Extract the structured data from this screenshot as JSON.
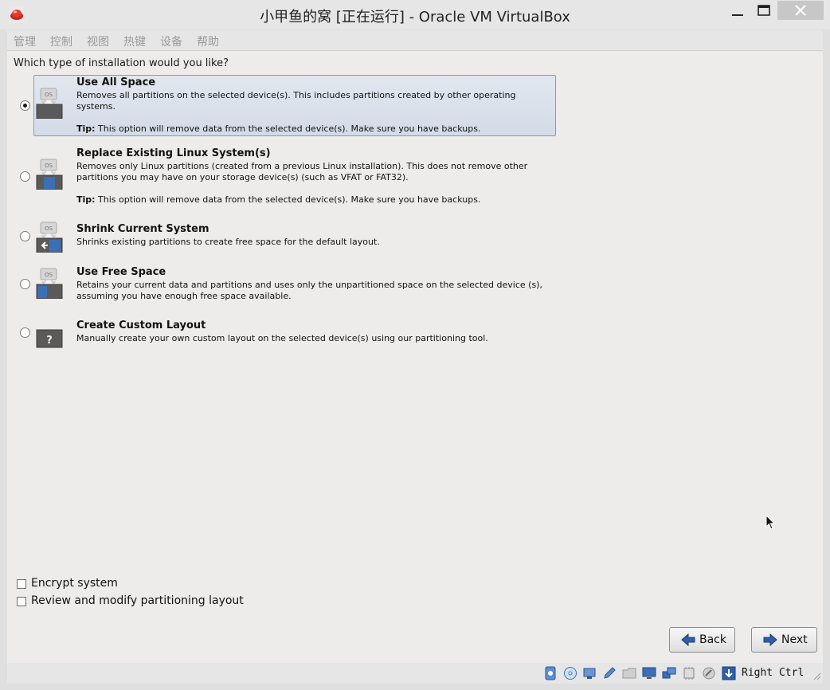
{
  "window": {
    "title": "小甲鱼的窝 [正在运行] - Oracle VM VirtualBox"
  },
  "menu": [
    "管理",
    "控制",
    "视图",
    "热键",
    "设备",
    "帮助"
  ],
  "installer": {
    "question": "Which type of installation would you like?",
    "options": [
      {
        "title": "Use All Space",
        "description": "Removes all partitions on the selected device(s).  This includes partitions created by other operating systems.",
        "tip_label": "Tip:",
        "tip": "This option will remove data from the selected device(s).  Make sure you have backups.",
        "icon": "os-disk-all-icon",
        "selected": true
      },
      {
        "title": "Replace Existing Linux System(s)",
        "description": "Removes only Linux partitions (created from a previous Linux installation).  This does not remove other partitions you may have on your storage device(s) (such as VFAT or FAT32).",
        "tip_label": "Tip:",
        "tip": "This option will remove data from the selected device(s).  Make sure you have backups.",
        "icon": "os-disk-replace-icon",
        "selected": false
      },
      {
        "title": "Shrink Current System",
        "description": "Shrinks existing partitions to create free space for the default layout.",
        "icon": "os-disk-shrink-icon",
        "selected": false
      },
      {
        "title": "Use Free Space",
        "description": "Retains your current data and partitions and uses only the unpartitioned space on the selected device (s), assuming you have enough free space available.",
        "icon": "os-disk-free-icon",
        "selected": false
      },
      {
        "title": "Create Custom Layout",
        "description": "Manually create your own custom layout on the selected device(s) using our partitioning tool.",
        "icon": "custom-disk-icon",
        "selected": false
      }
    ],
    "encrypt_label": "Encrypt system",
    "encrypt_checked": false,
    "review_label": "Review and modify partitioning layout",
    "review_checked": false,
    "back_label": "Back",
    "next_label": "Next"
  },
  "statusbar": {
    "host_key": "Right Ctrl",
    "icons": [
      "hard-disk-icon",
      "optical-disc-icon",
      "usb-icon",
      "pencil-icon",
      "shared-folder-icon",
      "display-icon",
      "network-icon",
      "cpu-icon",
      "mouse-integration-icon",
      "keyboard-capture-icon"
    ]
  },
  "colors": {
    "selection": "#d8dfea",
    "selection_border": "#8a9ab3",
    "arrow_blue": "#2f5fa8"
  }
}
